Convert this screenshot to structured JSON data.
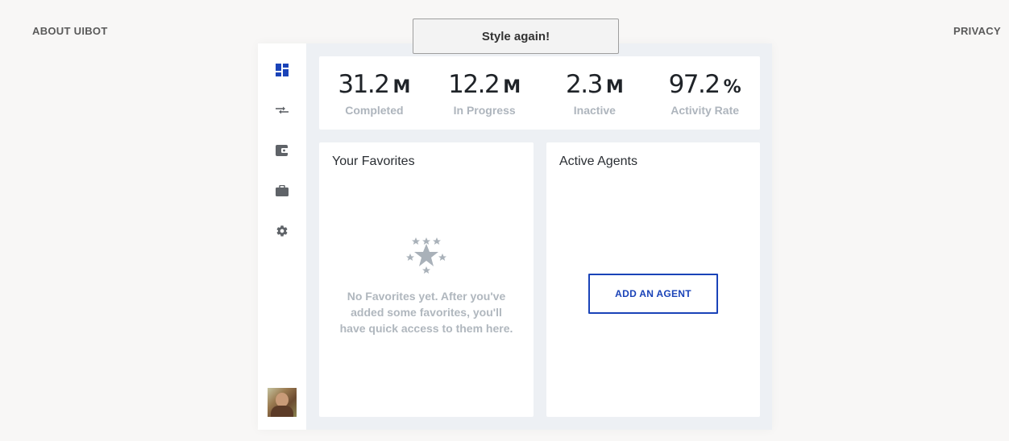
{
  "header": {
    "about_label": "ABOUT UIBOT",
    "privacy_label": "PRIVACY",
    "style_button_label": "Style again!"
  },
  "sidebar": {
    "items": [
      {
        "icon": "dashboard-icon",
        "active": true
      },
      {
        "icon": "transfer-icon"
      },
      {
        "icon": "wallet-icon"
      },
      {
        "icon": "briefcase-icon"
      },
      {
        "icon": "gear-icon"
      }
    ],
    "active_color": "#1a43b8",
    "icon_color": "#5f6368"
  },
  "stats": [
    {
      "value": "31.2",
      "unit": "M",
      "label": "Completed"
    },
    {
      "value": "12.2",
      "unit": "M",
      "label": "In Progress"
    },
    {
      "value": "2.3",
      "unit": "M",
      "label": "Inactive"
    },
    {
      "value": "97.2",
      "unit": "%",
      "label": "Activity Rate"
    }
  ],
  "favorites": {
    "title": "Your Favorites",
    "empty_line1": "No Favorites yet. After you've",
    "empty_line2": "added some favorites, you'll",
    "empty_line3": "have quick access to them here."
  },
  "agents": {
    "title": "Active Agents",
    "add_button_label": "ADD AN AGENT"
  },
  "colors": {
    "accent": "#1a43b8",
    "muted_text": "#aeb5bd",
    "app_background": "#edf0f4"
  }
}
